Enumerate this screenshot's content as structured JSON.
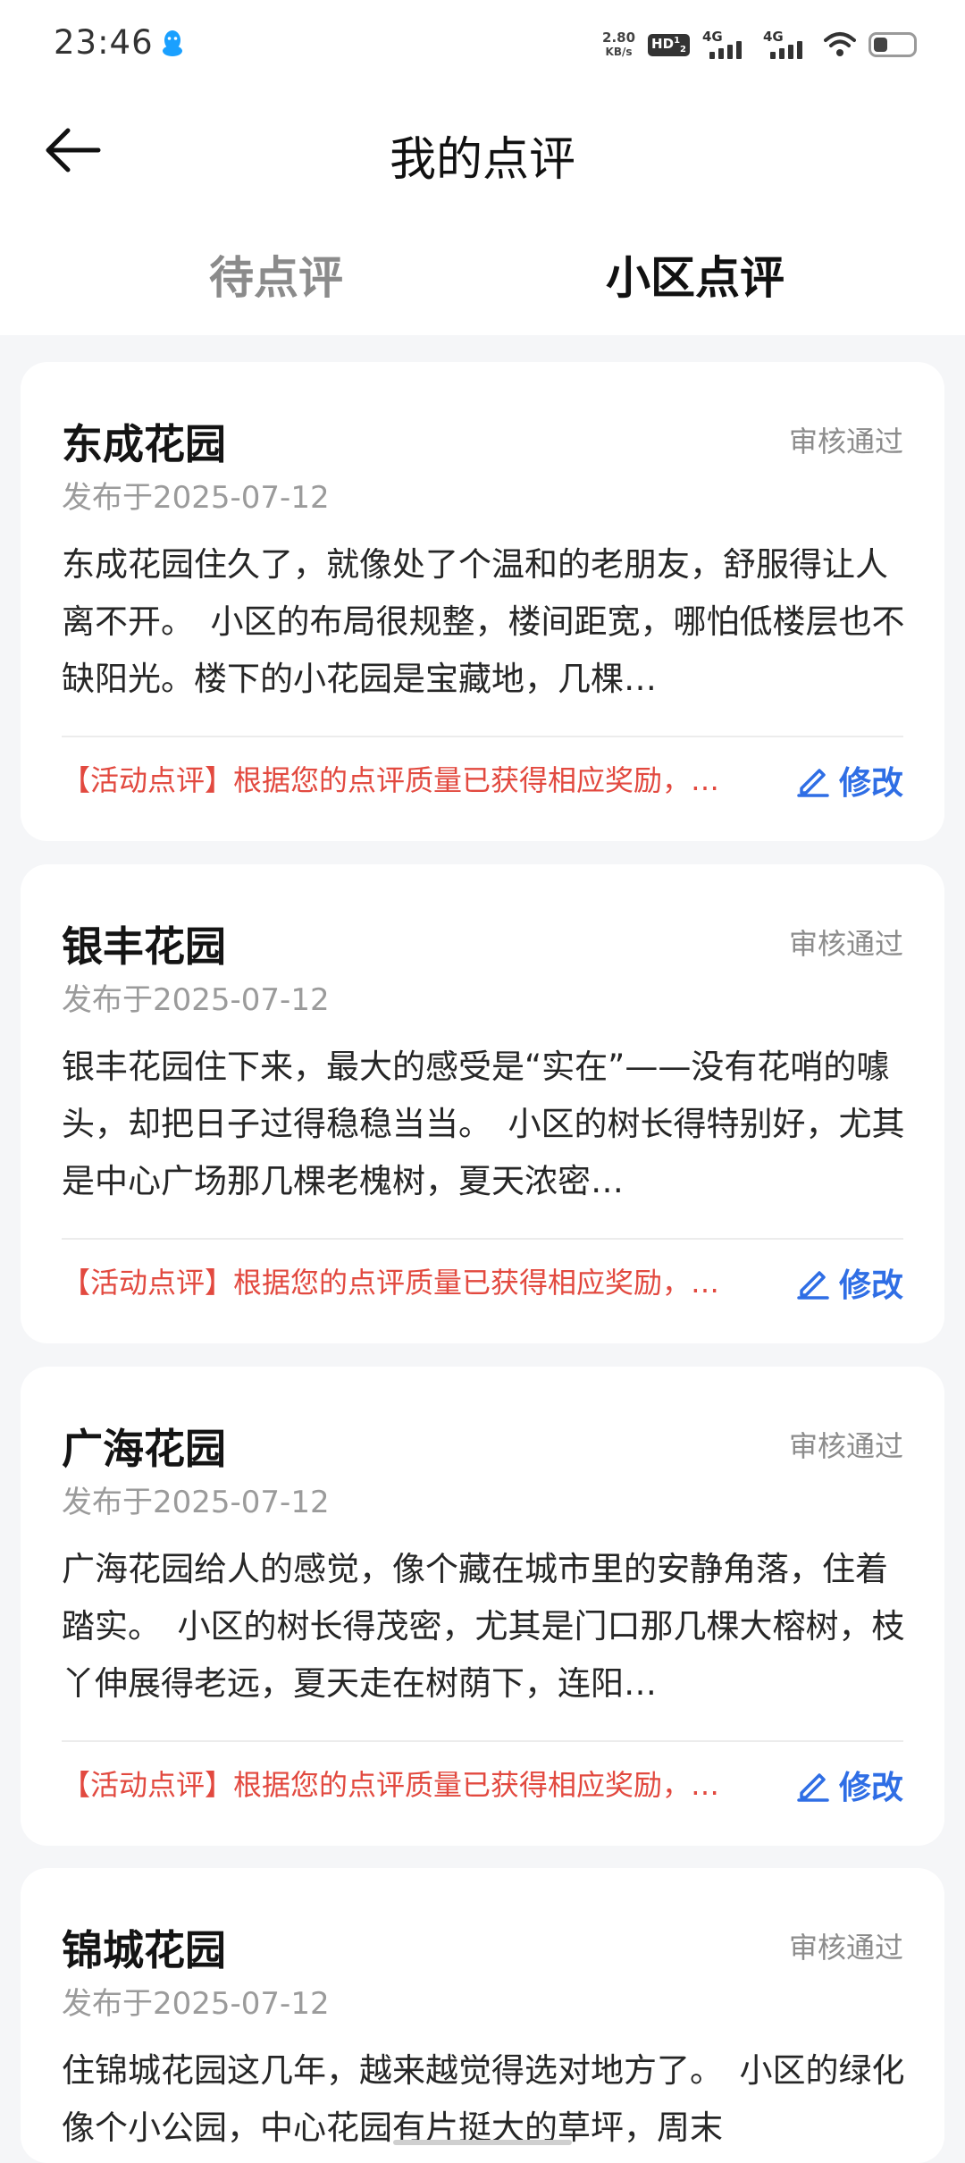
{
  "status_bar": {
    "time": "23:46",
    "speed_value": "2.80",
    "speed_unit": "KB/s",
    "hd_label": "HD",
    "hd_sup": "1",
    "hd_sub": "2",
    "net1": "4G",
    "net2": "4G",
    "battery_level": 0.35
  },
  "nav": {
    "title": "我的点评"
  },
  "tabs": [
    {
      "label": "待点评",
      "active": false
    },
    {
      "label": "小区点评",
      "active": true
    }
  ],
  "reviews": [
    {
      "name": "东成花园",
      "status": "审核通过",
      "date": "发布于2025-07-12",
      "content": "东成花园住久了，就像处了个温和的老朋友，舒服得让人离不开。　小区的布局很规整，楼间距宽，哪怕低楼层也不缺阳光。楼下的小花园是宝藏地，几棵…",
      "reward": "【活动点评】根据您的点评质量已获得相应奖励，…",
      "edit": "修改"
    },
    {
      "name": "银丰花园",
      "status": "审核通过",
      "date": "发布于2025-07-12",
      "content": "银丰花园住下来，最大的感受是“实在”——没有花哨的噱头，却把日子过得稳稳当当。　小区的树长得特别好，尤其是中心广场那几棵老槐树，夏天浓密…",
      "reward": "【活动点评】根据您的点评质量已获得相应奖励，…",
      "edit": "修改"
    },
    {
      "name": "广海花园",
      "status": "审核通过",
      "date": "发布于2025-07-12",
      "content": "广海花园给人的感觉，像个藏在城市里的安静角落，住着踏实。　小区的树长得茂密，尤其是门口那几棵大榕树，枝丫伸展得老远，夏天走在树荫下，连阳…",
      "reward": "【活动点评】根据您的点评质量已获得相应奖励，…",
      "edit": "修改"
    },
    {
      "name": "锦城花园",
      "status": "审核通过",
      "date": "发布于2025-07-12",
      "content": "住锦城花园这几年，越来越觉得选对地方了。　小区的绿化像个小公园，中心花园有片挺大的草坪，周末",
      "reward": "",
      "edit": ""
    }
  ]
}
